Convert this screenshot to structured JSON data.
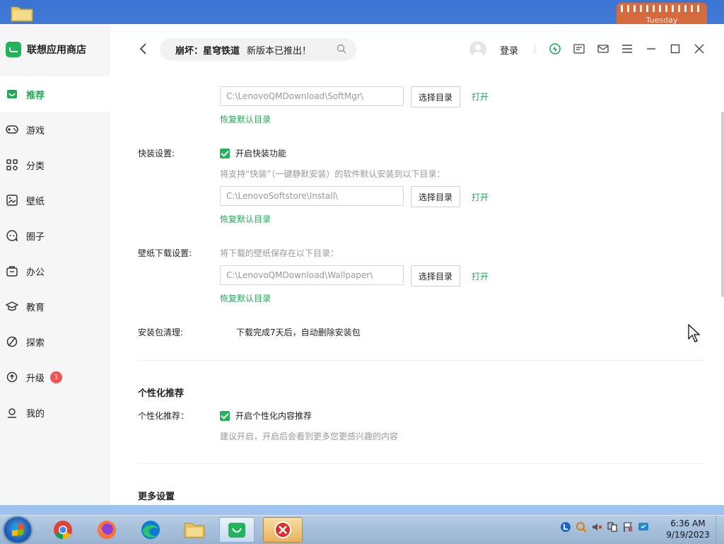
{
  "desktop": {
    "calendar_day": "Tuesday"
  },
  "app": {
    "name": "联想应用商店",
    "colors": {
      "accent": "#1fa954",
      "badge": "#f05454"
    }
  },
  "sidebar": {
    "items": [
      {
        "label": "推荐",
        "icon": "recommend-icon",
        "active": true
      },
      {
        "label": "游戏",
        "icon": "gamepad-icon"
      },
      {
        "label": "分类",
        "icon": "category-icon"
      },
      {
        "label": "壁纸",
        "icon": "wallpaper-icon"
      },
      {
        "label": "圈子",
        "icon": "community-icon"
      },
      {
        "label": "办公",
        "icon": "briefcase-icon"
      },
      {
        "label": "教育",
        "icon": "graduation-cap-icon"
      },
      {
        "label": "探索",
        "icon": "explore-icon"
      },
      {
        "label": "升级",
        "icon": "upgrade-icon",
        "badge": "1"
      },
      {
        "label": "我的",
        "icon": "user-icon"
      }
    ]
  },
  "topbar": {
    "search_query_bold": "崩坏：星穹铁道",
    "search_query_rest": "新版本已推出！",
    "login_label": "登录"
  },
  "settings": {
    "download": {
      "path": "C:\\LenovoQMDownload\\SoftMgr\\",
      "choose_label": "选择目录",
      "open_label": "打开",
      "restore_label": "恢复默认目录"
    },
    "quick_install": {
      "label": "快装设置:",
      "checkbox_label": "开启快装功能",
      "hint": "将支持“快装”（一键静默安装）的软件默认安装到以下目录：",
      "path": "C:\\LenovoSoftstore\\Install\\",
      "choose_label": "选择目录",
      "open_label": "打开",
      "restore_label": "恢复默认目录"
    },
    "wallpaper": {
      "label": "壁纸下载设置:",
      "hint": "将下载的壁纸保存在以下目录：",
      "path": "C:\\LenovoQMDownload\\Wallpaper\\",
      "choose_label": "选择目录",
      "open_label": "打开",
      "restore_label": "恢复默认目录"
    },
    "cleanup": {
      "label": "安装包清理:",
      "value": "下载完成7天后，自动删除安装包"
    },
    "personalization": {
      "section_title": "个性化推荐",
      "label": "个性化推荐：",
      "checkbox_label": "开启个性化内容推荐",
      "hint": "建议开启，开启后会看到更多您更感兴趣的内容"
    },
    "more": {
      "section_title": "更多设置"
    }
  },
  "taskbar": {
    "apps": [
      "chrome-icon",
      "firefox-icon",
      "edge-icon",
      "file-explorer-icon",
      "lenovo-store-icon",
      "error-icon"
    ],
    "time": "6:36 AM",
    "date": "9/19/2023"
  }
}
